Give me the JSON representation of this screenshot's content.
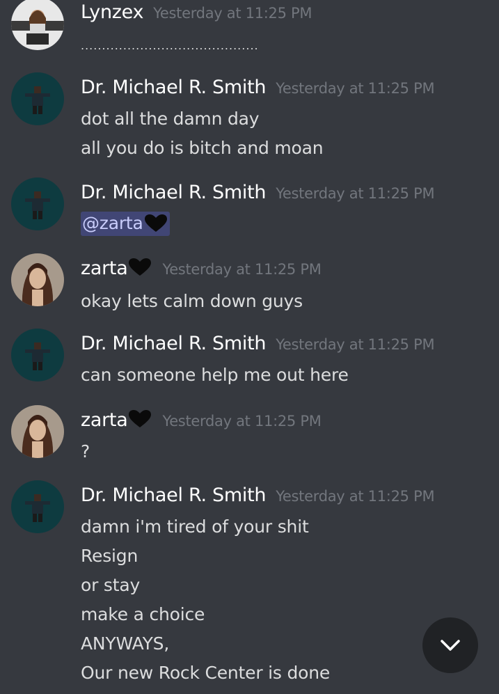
{
  "messages": [
    {
      "author": "Lynzex",
      "timestamp": "Yesterday at 11:25 PM",
      "avatar": "lynzex-avatar",
      "lines": [
        ".........................................."
      ]
    },
    {
      "author": "Dr. Michael R. Smith",
      "timestamp": "Yesterday at 11:25 PM",
      "avatar": "smith-avatar",
      "lines": [
        "dot all the damn day",
        "all you do is bitch and moan"
      ]
    },
    {
      "author": "Dr. Michael R. Smith",
      "timestamp": "Yesterday at 11:25 PM",
      "avatar": "smith-avatar",
      "mention": "@zarta"
    },
    {
      "author": "zarta",
      "timestamp": "Yesterday at 11:25 PM",
      "avatar": "zarta-avatar",
      "lines": [
        "okay lets calm down guys"
      ]
    },
    {
      "author": "Dr. Michael R. Smith",
      "timestamp": "Yesterday at 11:25 PM",
      "avatar": "smith-avatar",
      "lines": [
        "can someone help me out here"
      ]
    },
    {
      "author": "zarta",
      "timestamp": "Yesterday at 11:25 PM",
      "avatar": "zarta-avatar",
      "lines": [
        "?"
      ]
    },
    {
      "author": "Dr. Michael R. Smith",
      "timestamp": "Yesterday at 11:25 PM",
      "avatar": "smith-avatar",
      "lines": [
        "damn i'm tired of your shit",
        "Resign",
        "or stay",
        "make a choice",
        "ANYWAYS,",
        "Our new Rock Center is done"
      ]
    }
  ],
  "icons": {
    "heart": "black-heart-icon",
    "scroll": "chevron-down-icon"
  },
  "colors": {
    "background": "#36393f",
    "mention_bg": "#414675",
    "mention_text": "#c9cdfb",
    "timestamp": "#72767d",
    "message_text": "#dcddde"
  }
}
